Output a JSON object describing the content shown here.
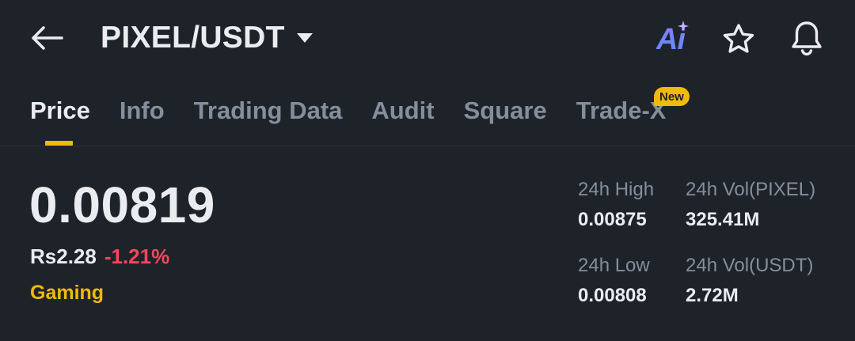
{
  "header": {
    "pair": "PIXEL/USDT",
    "ai_label": "Ai"
  },
  "tabs": [
    {
      "label": "Price",
      "active": true
    },
    {
      "label": "Info",
      "active": false
    },
    {
      "label": "Trading Data",
      "active": false
    },
    {
      "label": "Audit",
      "active": false
    },
    {
      "label": "Square",
      "active": false
    },
    {
      "label": "Trade-X",
      "active": false
    }
  ],
  "new_badge": "New",
  "price": {
    "last": "0.00819",
    "fiat": "Rs2.28",
    "change": "-1.21%",
    "tag": "Gaming"
  },
  "stats": {
    "high_label": "24h High",
    "high_value": "0.00875",
    "vol_base_label": "24h Vol(PIXEL)",
    "vol_base_value": "325.41M",
    "low_label": "24h Low",
    "low_value": "0.00808",
    "vol_quote_label": "24h Vol(USDT)",
    "vol_quote_value": "2.72M"
  },
  "colors": {
    "background": "#1e2329",
    "accent": "#f0b90b",
    "negative": "#f6465d",
    "text_primary": "#eaecef",
    "text_secondary": "#848e9c"
  },
  "icons": {
    "back": "arrow-left-icon",
    "caret": "caret-down-icon",
    "ai": "ai-sparkle-icon",
    "favorite": "star-icon",
    "alerts": "bell-icon"
  }
}
